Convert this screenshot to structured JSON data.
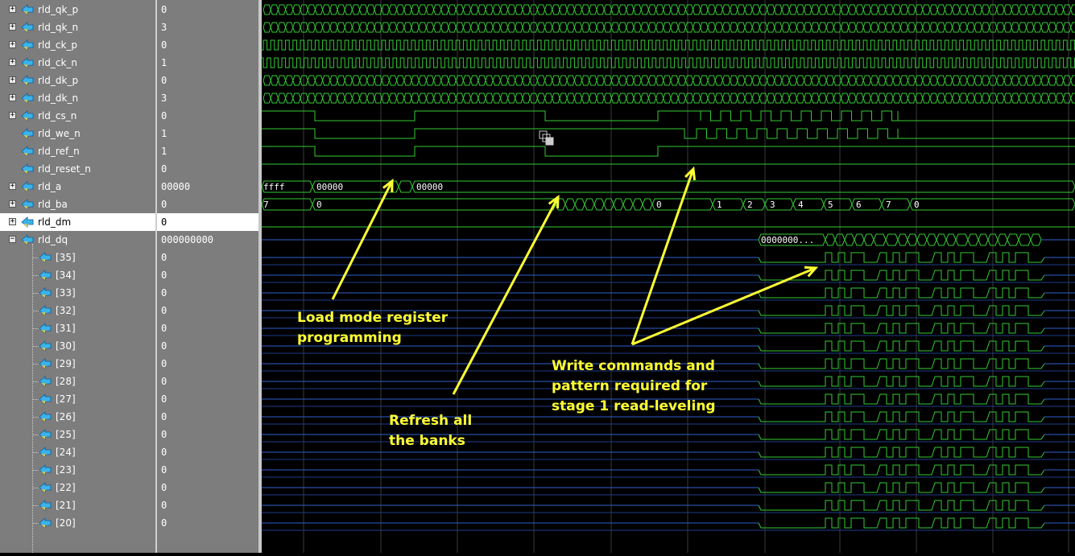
{
  "signals": [
    {
      "name": "rld_qk_p",
      "value": "0",
      "expandable": true,
      "icon": "bus-signal-icon"
    },
    {
      "name": "rld_qk_n",
      "value": "3",
      "expandable": true,
      "icon": "bus-signal-icon"
    },
    {
      "name": "rld_ck_p",
      "value": "0",
      "expandable": true,
      "icon": "bus-signal-icon"
    },
    {
      "name": "rld_ck_n",
      "value": "1",
      "expandable": true,
      "icon": "bus-signal-icon"
    },
    {
      "name": "rld_dk_p",
      "value": "0",
      "expandable": true,
      "icon": "bus-signal-icon"
    },
    {
      "name": "rld_dk_n",
      "value": "3",
      "expandable": true,
      "icon": "bus-signal-icon"
    },
    {
      "name": "rld_cs_n",
      "value": "0",
      "expandable": true,
      "icon": "bus-signal-icon"
    },
    {
      "name": "rld_we_n",
      "value": "1",
      "expandable": false,
      "icon": "wire-signal-icon"
    },
    {
      "name": "rld_ref_n",
      "value": "1",
      "expandable": false,
      "icon": "wire-signal-icon"
    },
    {
      "name": "rld_reset_n",
      "value": "0",
      "expandable": false,
      "icon": "wire-signal-icon"
    },
    {
      "name": "rld_a",
      "value": "00000",
      "expandable": true,
      "icon": "bus-signal-icon"
    },
    {
      "name": "rld_ba",
      "value": "0",
      "expandable": true,
      "icon": "bus-signal-icon"
    },
    {
      "name": "rld_dm",
      "value": "0",
      "expandable": true,
      "icon": "bus-signal-icon",
      "selected": true
    },
    {
      "name": "rld_dq",
      "value": "000000000",
      "expandable": true,
      "expanded": true,
      "icon": "bus-signal-icon"
    },
    {
      "name": "[35]",
      "value": "0",
      "child": true,
      "icon": "wire-signal-icon"
    },
    {
      "name": "[34]",
      "value": "0",
      "child": true,
      "icon": "wire-signal-icon"
    },
    {
      "name": "[33]",
      "value": "0",
      "child": true,
      "icon": "wire-signal-icon"
    },
    {
      "name": "[32]",
      "value": "0",
      "child": true,
      "icon": "wire-signal-icon"
    },
    {
      "name": "[31]",
      "value": "0",
      "child": true,
      "icon": "wire-signal-icon"
    },
    {
      "name": "[30]",
      "value": "0",
      "child": true,
      "icon": "wire-signal-icon"
    },
    {
      "name": "[29]",
      "value": "0",
      "child": true,
      "icon": "wire-signal-icon"
    },
    {
      "name": "[28]",
      "value": "0",
      "child": true,
      "icon": "wire-signal-icon"
    },
    {
      "name": "[27]",
      "value": "0",
      "child": true,
      "icon": "wire-signal-icon"
    },
    {
      "name": "[26]",
      "value": "0",
      "child": true,
      "icon": "wire-signal-icon"
    },
    {
      "name": "[25]",
      "value": "0",
      "child": true,
      "icon": "wire-signal-icon"
    },
    {
      "name": "[24]",
      "value": "0",
      "child": true,
      "icon": "wire-signal-icon"
    },
    {
      "name": "[23]",
      "value": "0",
      "child": true,
      "icon": "wire-signal-icon"
    },
    {
      "name": "[22]",
      "value": "0",
      "child": true,
      "icon": "wire-signal-icon"
    },
    {
      "name": "[21]",
      "value": "0",
      "child": true,
      "icon": "wire-signal-icon"
    },
    {
      "name": "[20]",
      "value": "0",
      "child": true,
      "icon": "wire-signal-icon"
    }
  ],
  "bus_labels": {
    "rld_a": [
      "ffff",
      "00000",
      "00000"
    ],
    "rld_ba": [
      "7",
      "0",
      "0",
      "1",
      "2",
      "3",
      "4",
      "5",
      "6",
      "7",
      "0"
    ],
    "rld_dq": [
      "0000000..."
    ]
  },
  "annotations": {
    "load_mode": [
      "Load mode register",
      "programming"
    ],
    "refresh": [
      "Refresh all",
      "the banks"
    ],
    "write_cmds": [
      "Write commands and",
      "pattern required for",
      "stage 1 read-leveling"
    ]
  },
  "colors": {
    "wave": "#33cc33",
    "dq_wave": "#2f5fd0",
    "annotation": "#ffff33",
    "names_bg": "#7d7d7d",
    "grid": "#3a3a3a"
  }
}
